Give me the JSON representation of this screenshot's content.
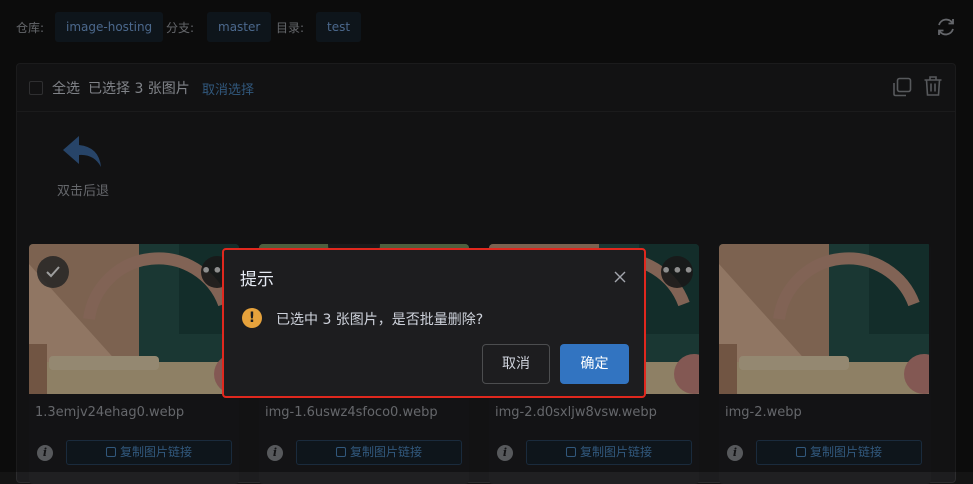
{
  "topbar": {
    "repo_label": "仓库:",
    "repo_value": "image-hosting",
    "branch_label": "分支:",
    "branch_value": "master",
    "dir_label": "目录:",
    "dir_value": "test",
    "refresh_icon": "refresh-icon"
  },
  "toolbar": {
    "select_all": "全选",
    "selected_text": "已选择 3 张图片",
    "cancel_selection": "取消选择",
    "copy_icon": "copy-icon",
    "delete_icon": "trash-icon"
  },
  "back": {
    "label": "双击后退",
    "icon": "back-arrow-icon"
  },
  "images": [
    {
      "filename": "1.3emjv24ehag0.webp",
      "copy_label": "复制图片链接",
      "selected": true
    },
    {
      "filename": "img-1.6uswz4sfoco0.webp",
      "copy_label": "复制图片链接",
      "selected": true
    },
    {
      "filename": "img-2.d0sxljw8vsw.webp",
      "copy_label": "复制图片链接",
      "selected": true
    },
    {
      "filename": "img-2.webp",
      "copy_label": "复制图片链接",
      "selected": false
    }
  ],
  "dialog": {
    "title": "提示",
    "message": "已选中 3 张图片，是否批量删除?",
    "cancel_label": "取消",
    "confirm_label": "确定",
    "icon": "warning-icon",
    "close_icon": "close-icon"
  },
  "colors": {
    "accent": "#3274c1",
    "link": "#4f8ec9",
    "warning": "#e6a23c",
    "highlight_border": "#e0281e"
  }
}
